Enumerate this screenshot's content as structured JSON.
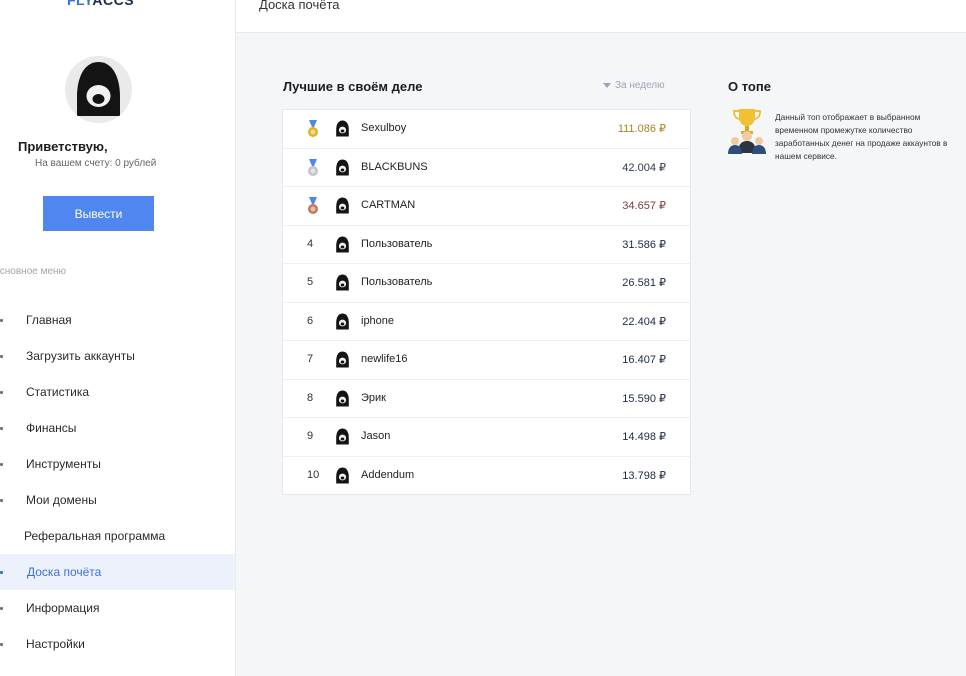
{
  "logo": {
    "part1": "FLY",
    "part2": "ACCS"
  },
  "user": {
    "greeting": "Приветствую,",
    "balance": "На вашем счету: 0 рублей",
    "withdraw_label": "Вывести"
  },
  "sidebar": {
    "menu_title": "Основное меню",
    "items": [
      {
        "label": "Главная"
      },
      {
        "label": "Загрузить аккаунты"
      },
      {
        "label": "Статистика"
      },
      {
        "label": "Финансы"
      },
      {
        "label": "Инструменты"
      },
      {
        "label": "Мои домены"
      },
      {
        "label": "Реферальная программа"
      },
      {
        "label": "Доска почёта",
        "active": true
      },
      {
        "label": "Информация"
      },
      {
        "label": "Настройки"
      }
    ]
  },
  "header": {
    "title": "Доска почёта"
  },
  "leaderboard": {
    "title": "Лучшие в своём деле",
    "period": "За неделю",
    "rows": [
      {
        "rank": "1",
        "medal": "gold",
        "name": "Sexulboy",
        "amount": "111.086 ₽"
      },
      {
        "rank": "2",
        "medal": "silver",
        "name": "BLACKBUNS",
        "amount": "42.004 ₽"
      },
      {
        "rank": "3",
        "medal": "bronze",
        "name": "CARTMAN",
        "amount": "34.657 ₽"
      },
      {
        "rank": "4",
        "name": "Пользователь",
        "amount": "31.586 ₽"
      },
      {
        "rank": "5",
        "name": "Пользователь",
        "amount": "26.581 ₽"
      },
      {
        "rank": "6",
        "name": "iphone",
        "amount": "22.404 ₽"
      },
      {
        "rank": "7",
        "name": "newlife16",
        "amount": "16.407 ₽"
      },
      {
        "rank": "8",
        "name": "Эрик",
        "amount": "15.590 ₽"
      },
      {
        "rank": "9",
        "name": "Jason",
        "amount": "14.498 ₽"
      },
      {
        "rank": "10",
        "name": "Addendum",
        "amount": "13.798 ₽"
      }
    ]
  },
  "about": {
    "title": "О топе",
    "text": "Данный топ отображает в выбранном временном промежутке количество заработанных денег на продаже аккаунтов в нашем сервисе.",
    "icon": "trophy-users-icon"
  },
  "colors": {
    "accent": "#4f86f0",
    "gold": "#e0b21f",
    "silver": "#bfc3c9",
    "bronze": "#c0785a"
  }
}
